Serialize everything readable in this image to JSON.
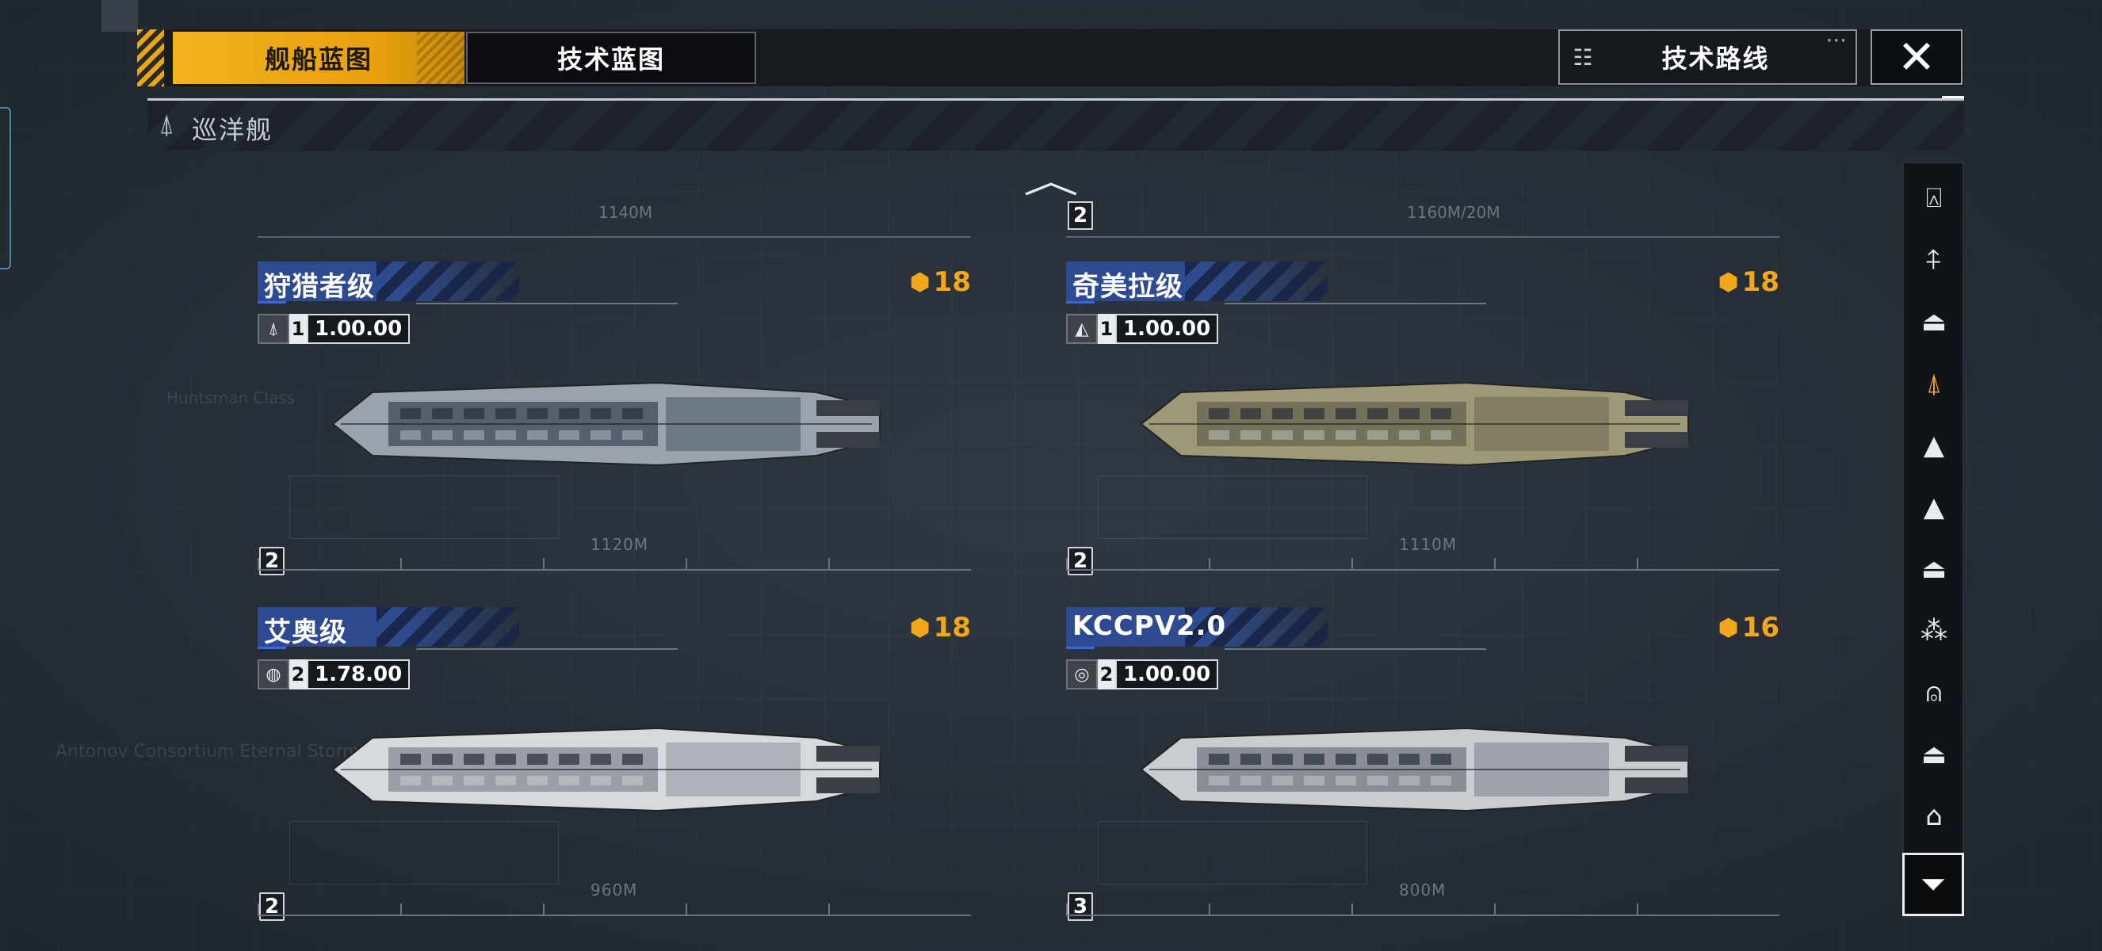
{
  "tabs": {
    "ships_label": "舰船蓝图",
    "tech_label": "技术蓝图"
  },
  "route_button": {
    "label": "技术路线",
    "dots": "···"
  },
  "close_button": {
    "glyph": "✕"
  },
  "category": {
    "label": "巡洋舰",
    "icon": "cruiser-icon"
  },
  "scroll_up": {
    "glyph": "︿"
  },
  "colors": {
    "accent": "#f2b21c",
    "cost": "#f3a81c",
    "title_bar": "#2d4a92"
  },
  "ships": [
    {
      "name": "狩猎者级",
      "level": "1",
      "version": "1.00.00",
      "cost": "18",
      "hull_no": "2",
      "length": "1120M",
      "type_icon": "rocket-icon",
      "hull_color": "#9aa3ad",
      "hull_dark": "#4a5462"
    },
    {
      "name": "奇美拉级",
      "level": "1",
      "version": "1.00.00",
      "cost": "18",
      "hull_no": "2",
      "length": "1110M",
      "type_icon": "faction-icon",
      "hull_color": "#9c9878",
      "hull_dark": "#6c6a52"
    },
    {
      "name": "艾奥级",
      "level": "2",
      "version": "1.78.00",
      "cost": "18",
      "hull_no": "2",
      "length": "960M",
      "type_icon": "planet-icon",
      "hull_color": "#d7dadd",
      "hull_dark": "#8e949a"
    },
    {
      "name": "KCCPV2.0",
      "level": "2",
      "version": "1.00.00",
      "cost": "16",
      "hull_no": "3",
      "length": "800M",
      "type_icon": "globe-icon",
      "hull_color": "#c9ccd0",
      "hull_dark": "#7c8288"
    }
  ],
  "top_lengths": [
    "1140M",
    "1160M/20M"
  ],
  "top_hull_no": "2",
  "sidebar": [
    {
      "icon": "frigate-icon",
      "glyph": "⍓"
    },
    {
      "icon": "destroyer-icon",
      "glyph": "⍏"
    },
    {
      "icon": "carrier-icon",
      "glyph": "⏏"
    },
    {
      "icon": "cruiser-icon",
      "glyph": "⍋"
    },
    {
      "icon": "battlecruiser-icon",
      "glyph": "▲"
    },
    {
      "icon": "battleship-icon",
      "glyph": "▲"
    },
    {
      "icon": "auxiliary-icon",
      "glyph": "⏏"
    },
    {
      "icon": "fighter-icon",
      "glyph": "⁂"
    },
    {
      "icon": "corvette-icon",
      "glyph": "⍝"
    },
    {
      "icon": "hangar-icon",
      "glyph": "⏏"
    },
    {
      "icon": "station-icon",
      "glyph": "⌂"
    }
  ],
  "filter_icon": "filter-icon"
}
